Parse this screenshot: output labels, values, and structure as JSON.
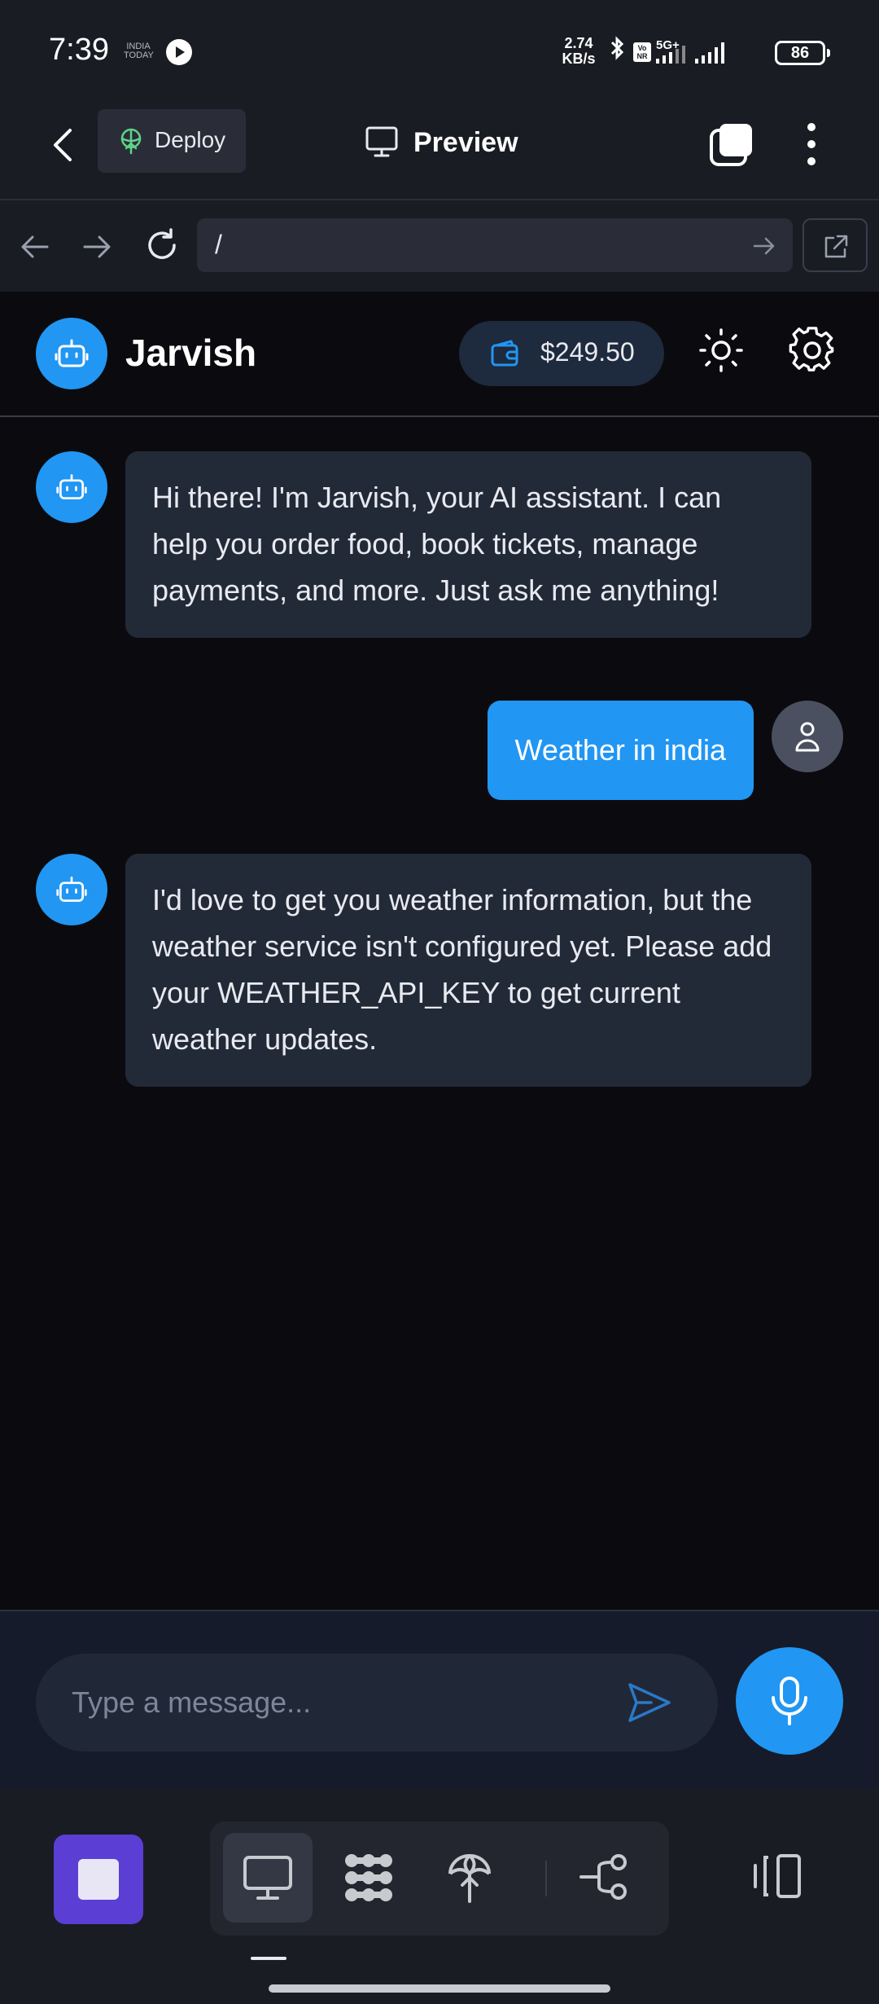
{
  "status_bar": {
    "time": "7:39",
    "news_badge": "INDIA TODAY",
    "speed": "2.74",
    "speed_unit": "KB/s",
    "network": "5G+",
    "volte": "Vo NR",
    "battery": "86"
  },
  "app_bar": {
    "deploy_label": "Deploy",
    "preview_label": "Preview"
  },
  "browser": {
    "url": "/"
  },
  "app": {
    "title": "Jarvish",
    "wallet_amount": "$249.50",
    "colors": {
      "accent": "#2196f3",
      "bot_bubble": "#222a38",
      "background": "#0b0b0f"
    },
    "messages": [
      {
        "role": "assistant",
        "text": "Hi there! I'm Jarvish, your AI assistant. I can help you order food, book tickets, manage payments, and more. Just ask me anything!"
      },
      {
        "role": "user",
        "text": "Weather in india"
      },
      {
        "role": "assistant",
        "text": "I'd love to get you weather information, but the weather service isn't configured yet. Please add your WEATHER_API_KEY to get current weather updates."
      }
    ],
    "composer": {
      "placeholder": "Type a message...",
      "value": ""
    }
  },
  "toolbar": {
    "tools": [
      "preview-icon",
      "apps-grid-icon",
      "deploy-icon",
      "git-branch-icon"
    ],
    "active_tool": "preview-icon"
  }
}
